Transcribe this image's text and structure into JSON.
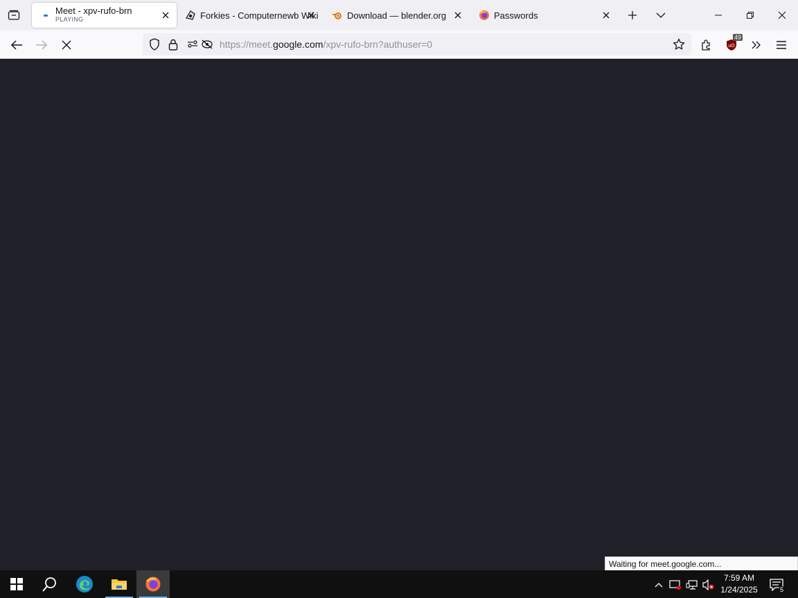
{
  "browser": {
    "tabs": [
      {
        "title": "Meet - xpv-rufo-brn",
        "subtitle": "PLAYING",
        "icon": "meet-dot-icon",
        "active": true
      },
      {
        "title": "Forkies - Computernewb Wiki",
        "icon": "wiki-icon",
        "active": false
      },
      {
        "title": "Download — blender.org",
        "icon": "blender-icon",
        "active": false
      },
      {
        "title": "Passwords",
        "icon": "firefox-icon",
        "active": false
      }
    ],
    "url": {
      "prefix": "https://meet.",
      "host": "google.com",
      "path": "/xpv-rufo-brn?authuser=0"
    },
    "extension_badge": "49",
    "status_text": "Waiting for meet.google.com...",
    "colors": {
      "accent": "#0060df",
      "content_bg": "#202028",
      "meet_blue": "#1a73e8"
    }
  },
  "taskbar": {
    "apps": [
      "windows-start-icon",
      "search-icon",
      "edge-icon",
      "file-explorer-icon",
      "firefox-icon"
    ],
    "clock": {
      "time": "7:59 AM",
      "date": "1/24/2025"
    },
    "notification_count": "5"
  }
}
